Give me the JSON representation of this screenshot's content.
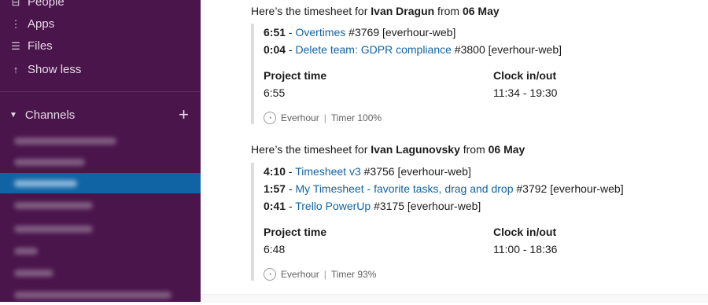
{
  "sidebar": {
    "items": [
      {
        "icon": "people-icon",
        "glyph": "⊟",
        "label": "People"
      },
      {
        "icon": "apps-icon",
        "glyph": "⋮",
        "label": "Apps"
      },
      {
        "icon": "files-icon",
        "glyph": "☰",
        "label": "Files"
      },
      {
        "icon": "arrow-up-icon",
        "glyph": "↑",
        "label": "Show less"
      }
    ],
    "channels_label": "Channels",
    "caret": "▼",
    "add": "+"
  },
  "messages": [
    {
      "prefix": "Here’s the timesheet for ",
      "name": "Ivan Dragun",
      "from": " from ",
      "date": "06 May",
      "tasks": [
        {
          "time": "6:51",
          "sep": " - ",
          "link": "Overtimes",
          "rest": " #3769 [everhour-web]"
        },
        {
          "time": "0:04",
          "sep": " - ",
          "link": "Delete team: GDPR compliance",
          "rest": " #3800 [everhour-web]"
        }
      ],
      "project_label": "Project time",
      "project_value": "6:55",
      "clock_label": "Clock in/out",
      "clock_value": "11:34 - 19:30",
      "app": "Everhour",
      "bar": "|",
      "timer": "Timer 100%"
    },
    {
      "prefix": "Here’s the timesheet for ",
      "name": "Ivan Lagunovsky",
      "from": " from ",
      "date": "06 May",
      "tasks": [
        {
          "time": "4:10",
          "sep": " - ",
          "link": "Timesheet v3",
          "rest": " #3756 [everhour-web]"
        },
        {
          "time": "1:57",
          "sep": " - ",
          "link": "My Timesheet - favorite tasks, drag and drop",
          "rest": " #3792 [everhour-web]"
        },
        {
          "time": "0:41",
          "sep": " - ",
          "link": "Trello PowerUp",
          "rest": " #3175 [everhour-web]"
        }
      ],
      "project_label": "Project time",
      "project_value": "6:48",
      "clock_label": "Clock in/out",
      "clock_value": "11:00 - 18:36",
      "app": "Everhour",
      "bar": "|",
      "timer": "Timer 93%"
    }
  ]
}
